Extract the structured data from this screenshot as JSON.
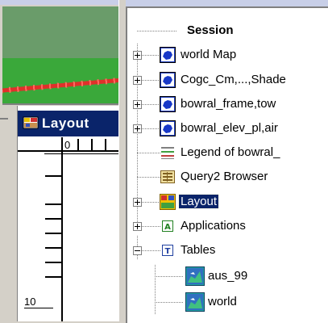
{
  "layout_window": {
    "title": "Layout"
  },
  "ruler": {
    "h_label": "0",
    "v_label": "10"
  },
  "tree": {
    "root": "Session",
    "items": [
      {
        "label": "world Map",
        "icon": "map-view-icon"
      },
      {
        "label": "Cogc_Cm,...,Shade",
        "icon": "map-view-icon"
      },
      {
        "label": "bowral_frame,tow",
        "icon": "map-view-icon"
      },
      {
        "label": "bowral_elev_pl,air",
        "icon": "map-view-icon"
      },
      {
        "label": "Legend of bowral_",
        "icon": "legend-icon"
      },
      {
        "label": "Query2 Browser",
        "icon": "browser-icon"
      },
      {
        "label": "Layout",
        "icon": "layout-icon",
        "selected": true
      },
      {
        "label": "Applications",
        "icon": "applications-icon"
      },
      {
        "label": "Tables",
        "icon": "tables-icon"
      },
      {
        "label": "aus_99",
        "icon": "table-icon"
      },
      {
        "label": "world",
        "icon": "table-icon"
      }
    ]
  },
  "colors": {
    "selection": "#0a246a",
    "map_green": "#3aa83a",
    "road_red": "#e0302a",
    "window_bg": "#d4d0c8"
  }
}
